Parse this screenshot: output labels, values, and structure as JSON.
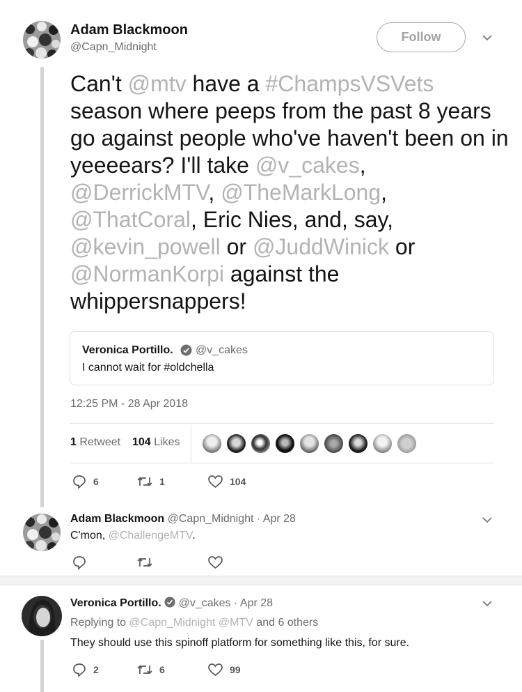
{
  "tweet": {
    "name": "Adam Blackmoon",
    "handle": "@Capn_Midnight",
    "follow_label": "Follow",
    "text": {
      "p1": "Can't ",
      "m_mtv": "@mtv",
      "p2": " have a ",
      "h_champs": "#ChampsVSVets",
      "p3": " season where peeps from the past 8 years go against people who've haven't been on in yeeeears? I'll take ",
      "m_vcakes": "@v_cakes",
      "p4": ", ",
      "m_derrick": "@DerrickMTV",
      "p5": ", ",
      "m_mark": "@TheMarkLong",
      "p6": ", ",
      "m_coral": "@ThatCoral",
      "p7": ", Eric Nies, and, say, ",
      "m_kevin": "@kevin_powell",
      "p8": " or ",
      "m_judd": "@JuddWinick",
      "p9": " or ",
      "m_norman": "@NormanKorpi",
      "p10": " against the whippersnappers!"
    },
    "quote": {
      "name": "Veronica Portillo.",
      "handle": "@v_cakes",
      "text": "I cannot wait for #oldchella"
    },
    "timestamp": "12:25 PM - 28 Apr 2018",
    "stats": {
      "retweets_count": "1",
      "retweets_label": "Retweet",
      "likes_count": "104",
      "likes_label": "Likes"
    },
    "actions": {
      "replies": "6",
      "retweets": "1",
      "likes": "104"
    }
  },
  "reply1": {
    "name": "Adam Blackmoon",
    "handle": "@Capn_Midnight",
    "date": "· Apr 28",
    "text_prefix": "C'mon, ",
    "mention": "@ChallengeMTV",
    "text_suffix": "."
  },
  "reply2": {
    "name": "Veronica Portillo.",
    "handle": "@v_cakes",
    "date": "· Apr 28",
    "replying_prefix": "Replying to ",
    "replying_to1": "@Capn_Midnight",
    "replying_to2": "@MTV",
    "replying_suffix": "and 6 others",
    "text": "They should use this spinoff platform for something like this, for sure.",
    "actions": {
      "replies": "2",
      "retweets": "6",
      "likes": "99"
    }
  },
  "colors": {
    "text": "#141414",
    "muted": "#6b6b6b",
    "link": "#b3b3b3",
    "line": "#d4d4d4"
  },
  "icons": [
    "chevron-down-icon",
    "verified-icon",
    "reply-icon",
    "retweet-icon",
    "heart-icon"
  ]
}
